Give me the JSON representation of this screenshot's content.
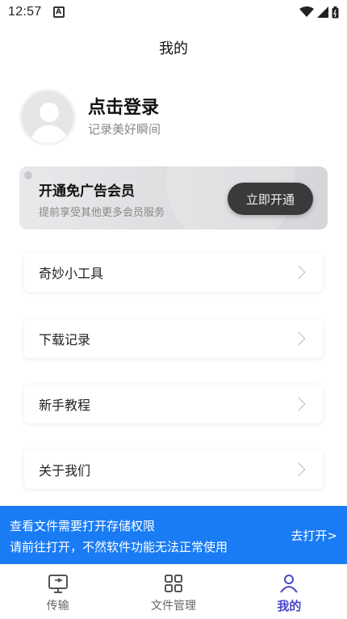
{
  "status_bar": {
    "time": "12:57",
    "notif_letter": "A"
  },
  "header": {
    "title": "我的"
  },
  "profile": {
    "login_title": "点击登录",
    "login_subtitle": "记录美好瞬间"
  },
  "vip": {
    "title": "开通免广告会员",
    "subtitle": "提前享受其他更多会员服务",
    "button": "立即开通"
  },
  "menu": {
    "items": [
      {
        "label": "奇妙小工具"
      },
      {
        "label": "下载记录"
      },
      {
        "label": "新手教程"
      },
      {
        "label": "关于我们"
      }
    ]
  },
  "permission_banner": {
    "line1": "查看文件需要打开存储权限",
    "line2": "请前往打开，不然软件功能无法正常使用",
    "action": "去打开>"
  },
  "tabbar": {
    "tabs": [
      {
        "label": "传输",
        "icon": "transfer-icon"
      },
      {
        "label": "文件管理",
        "icon": "grid-icon"
      },
      {
        "label": "我的",
        "icon": "person-icon"
      }
    ],
    "active_color": "#4a47c8"
  },
  "colors": {
    "accent": "#1a7cf5",
    "vip_button": "#3a3a3c"
  }
}
